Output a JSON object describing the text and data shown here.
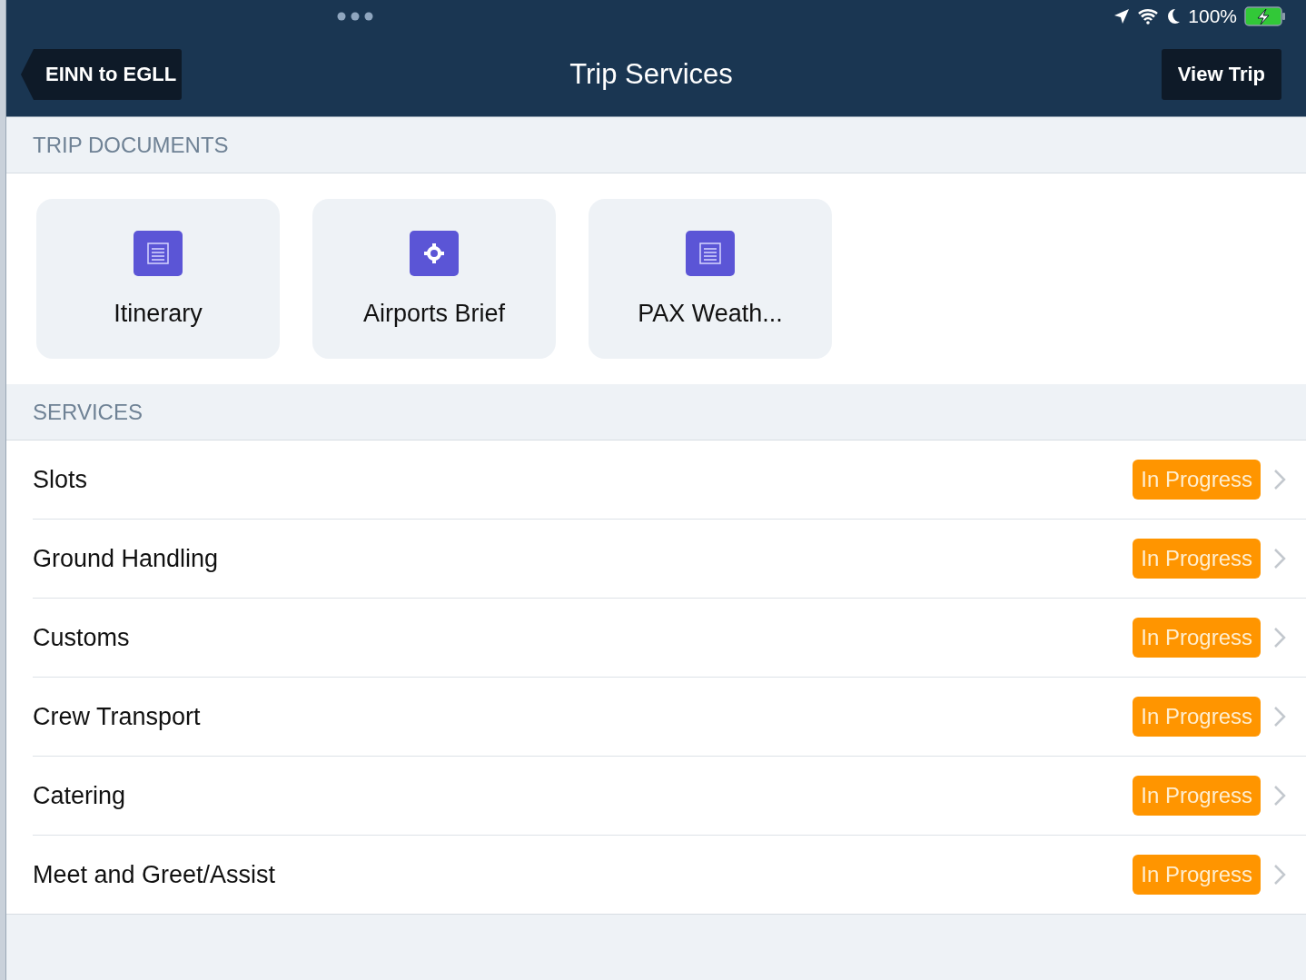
{
  "status_bar": {
    "battery": "100%"
  },
  "nav": {
    "back": "EINN to EGLL",
    "title": "Trip Services",
    "action": "View Trip"
  },
  "trip_documents": {
    "heading": "TRIP DOCUMENTS",
    "items": [
      {
        "label": "Itinerary",
        "kind": "document"
      },
      {
        "label": "Airports Brief",
        "kind": "target"
      },
      {
        "label": "PAX Weath...",
        "kind": "document"
      }
    ]
  },
  "services": {
    "heading": "SERVICES",
    "rows": [
      {
        "name": "Slots",
        "status": "In Progress"
      },
      {
        "name": "Ground Handling",
        "status": "In Progress"
      },
      {
        "name": "Customs",
        "status": "In Progress"
      },
      {
        "name": "Crew Transport",
        "status": "In Progress"
      },
      {
        "name": "Catering",
        "status": "In Progress"
      },
      {
        "name": "Meet and Greet/Assist",
        "status": "In Progress"
      }
    ]
  }
}
